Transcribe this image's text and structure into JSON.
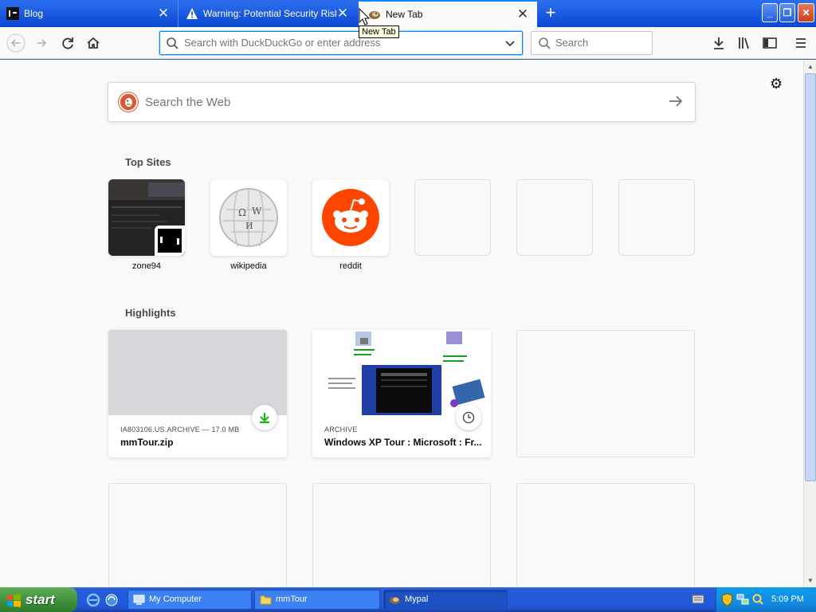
{
  "tabs": [
    {
      "title": "Blog",
      "icon": "blog-favicon"
    },
    {
      "title": "Warning: Potential Security Risk Ahead",
      "icon": "warning-icon"
    },
    {
      "title": "New Tab",
      "icon": "mypal-favicon",
      "active": true
    }
  ],
  "tooltip": "New Tab",
  "navbar": {
    "url_placeholder": "Search with DuckDuckGo or enter address",
    "search_placeholder": "Search"
  },
  "newtab": {
    "web_search_placeholder": "Search the Web",
    "top_sites_title": "Top Sites",
    "top_sites": [
      {
        "label": "zone94"
      },
      {
        "label": "wikipedia"
      },
      {
        "label": "reddit"
      },
      {
        "label": ""
      },
      {
        "label": ""
      },
      {
        "label": ""
      }
    ],
    "highlights_title": "Highlights",
    "highlights": [
      {
        "source": "IA803106.US.ARCHIVE — 17.0 MB",
        "title": "mmTour.zip",
        "badge": "download-icon"
      },
      {
        "source": "ARCHIVE",
        "title": "Windows XP Tour : Microsoft : Fr...",
        "badge": "clock-icon"
      }
    ]
  },
  "taskbar": {
    "start_label": "start",
    "tasks": [
      {
        "label": "My Computer",
        "icon": "computer-icon"
      },
      {
        "label": "mmTour",
        "icon": "folder-icon"
      },
      {
        "label": "Mypal",
        "icon": "mypal-icon",
        "active": true
      }
    ],
    "clock": "5:09 PM"
  },
  "colors": {
    "titlebar": "#0a48d0",
    "accent": "#0a84ff",
    "reddit": "#ff4500",
    "duckduckgo": "#de5833",
    "download_green": "#12bc00"
  }
}
